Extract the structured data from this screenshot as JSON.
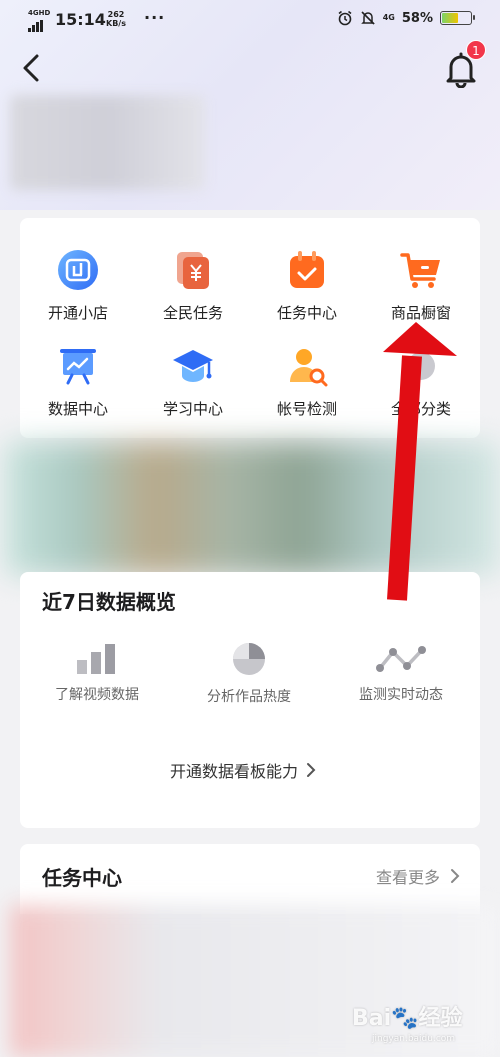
{
  "status_bar": {
    "network": "4GHD",
    "time": "15:14",
    "speed_value": "262",
    "speed_unit": "KB/s",
    "dots": "···",
    "right_net": "4G",
    "battery": "58%"
  },
  "header": {
    "notification_count": "1"
  },
  "tools": [
    {
      "label": "开通小店",
      "icon": "store-icon"
    },
    {
      "label": "全民任务",
      "icon": "yuan-task-icon"
    },
    {
      "label": "任务中心",
      "icon": "calendar-check-icon"
    },
    {
      "label": "商品橱窗",
      "icon": "shopping-cart-icon"
    },
    {
      "label": "数据中心",
      "icon": "chart-board-icon"
    },
    {
      "label": "学习中心",
      "icon": "graduation-cap-icon"
    },
    {
      "label": "帐号检测",
      "icon": "user-search-icon"
    },
    {
      "label": "全部分类",
      "icon": "grid-icon"
    }
  ],
  "data_overview": {
    "title": "近7日数据概览",
    "features": [
      {
        "label": "了解视频数据",
        "icon": "bar-chart-icon"
      },
      {
        "label": "分析作品热度",
        "icon": "pie-chart-icon"
      },
      {
        "label": "监测实时动态",
        "icon": "line-trend-icon"
      }
    ],
    "open_link": "开通数据看板能力"
  },
  "task_center": {
    "title": "任务中心",
    "more": "查看更多"
  },
  "watermark": {
    "text": "Bai🐾经验",
    "sub": "jingyan.baidu.com"
  },
  "colors": {
    "accent_orange": "#ff6a1f",
    "accent_blue": "#3a8cff",
    "badge_red": "#f2364a",
    "arrow_red": "#e10d14"
  }
}
